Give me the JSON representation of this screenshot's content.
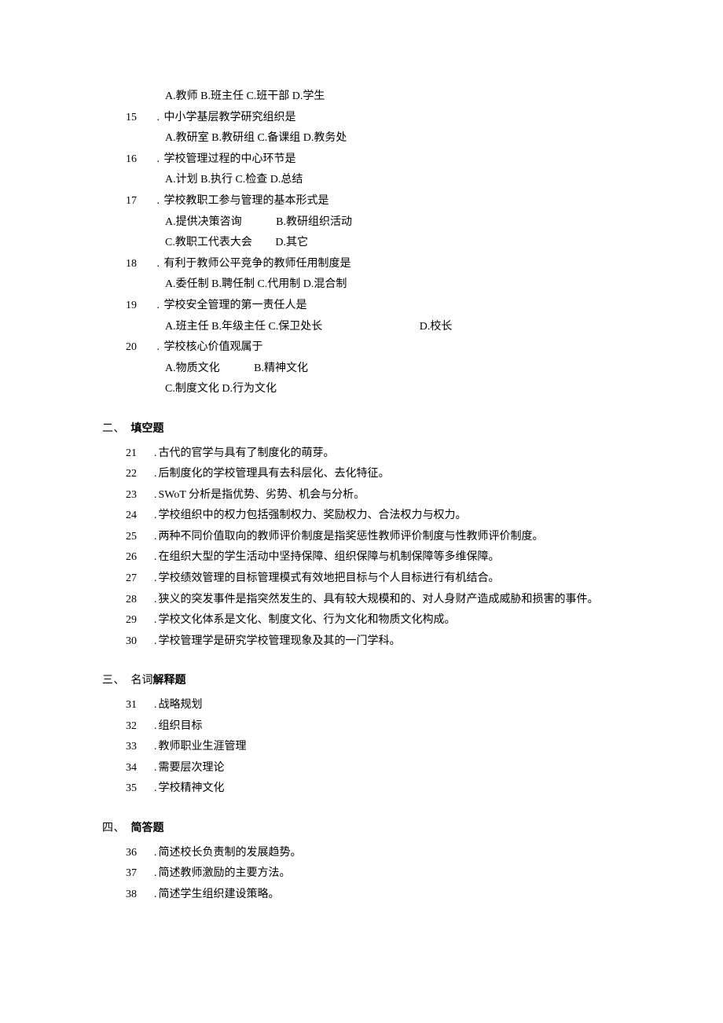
{
  "q14_options": "A.教师 B.班主任 C.班干部 D.学生",
  "mcq": [
    {
      "num": "15",
      "stem": "中小学基层教学研究组织是",
      "opts": [
        "A.教研室 B.教研组 C.备课组 D.教务处"
      ]
    },
    {
      "num": "16",
      "stem": "学校管理过程的中心环节是",
      "opts": [
        "A.计划 B.执行 C.检查 D.总结"
      ]
    },
    {
      "num": "17",
      "stem": "学校教职工参与管理的基本形式是",
      "twocol": [
        {
          "a": "A.提供决策咨询",
          "b": "B.教研组织活动"
        },
        {
          "a": "C.教职工代表大会",
          "b": "D.其它"
        }
      ]
    },
    {
      "num": "18",
      "stem": "有利于教师公平竞争的教师任用制度是",
      "opts": [
        "A.委任制 B.聘任制 C.代用制 D.混合制"
      ]
    },
    {
      "num": "19",
      "stem": "学校安全管理的第一责任人是",
      "opt_special": {
        "abc": "A.班主任 B.年级主任 C.保卫处长",
        "d": "D.校长"
      }
    },
    {
      "num": "20",
      "stem": "学校核心价值观属于",
      "twocol": [
        {
          "a": "A.物质文化",
          "b": "B.精神文化"
        }
      ],
      "last": "C.制度文化 D.行为文化"
    }
  ],
  "sections": {
    "s2": {
      "label": "二、",
      "title_plain": "填空题"
    },
    "s3": {
      "label": "三、",
      "title_plain": "名词",
      "title_bold": "解释题"
    },
    "s4": {
      "label": "四、",
      "title_bold": "简答题"
    }
  },
  "fill": [
    {
      "num": "21",
      "text": "古代的官学与具有了制度化的萌芽。"
    },
    {
      "num": "22",
      "text": "后制度化的学校管理具有去科层化、去化特征。"
    },
    {
      "num": "23",
      "text": "SWoT 分析是指优势、劣势、机会与分析。"
    },
    {
      "num": "24",
      "text": "学校组织中的权力包括强制权力、奖励权力、合法权力与权力。"
    },
    {
      "num": "25",
      "text": "两种不同价值取向的教师评价制度是指奖惩性教师评价制度与性教师评价制度。"
    },
    {
      "num": "26",
      "text": "在组织大型的学生活动中坚持保障、组织保障与机制保障等多维保障。"
    },
    {
      "num": "27",
      "text": "学校绩效管理的目标管理模式有效地把目标与个人目标进行有机结合。"
    },
    {
      "num": "28",
      "text": "狭义的突发事件是指突然发生的、具有较大规模和的、对人身财产造成威胁和损害的事件。"
    },
    {
      "num": "29",
      "text": "学校文化体系是文化、制度文化、行为文化和物质文化构成。"
    },
    {
      "num": "30",
      "text": "学校管理学是研究学校管理现象及其的一门学科。"
    }
  ],
  "terms": [
    {
      "num": "31",
      "text": "战略规划"
    },
    {
      "num": "32",
      "text": "组织目标"
    },
    {
      "num": "33",
      "text": "教师职业生涯管理"
    },
    {
      "num": "34",
      "text": "需要层次理论"
    },
    {
      "num": "35",
      "text": "学校精神文化"
    }
  ],
  "short": [
    {
      "num": "36",
      "text": "简述校长负责制的发展趋势。"
    },
    {
      "num": "37",
      "text": "简述教师激励的主要方法。"
    },
    {
      "num": "38",
      "text": "简述学生组织建设策略。"
    }
  ],
  "dot": "."
}
